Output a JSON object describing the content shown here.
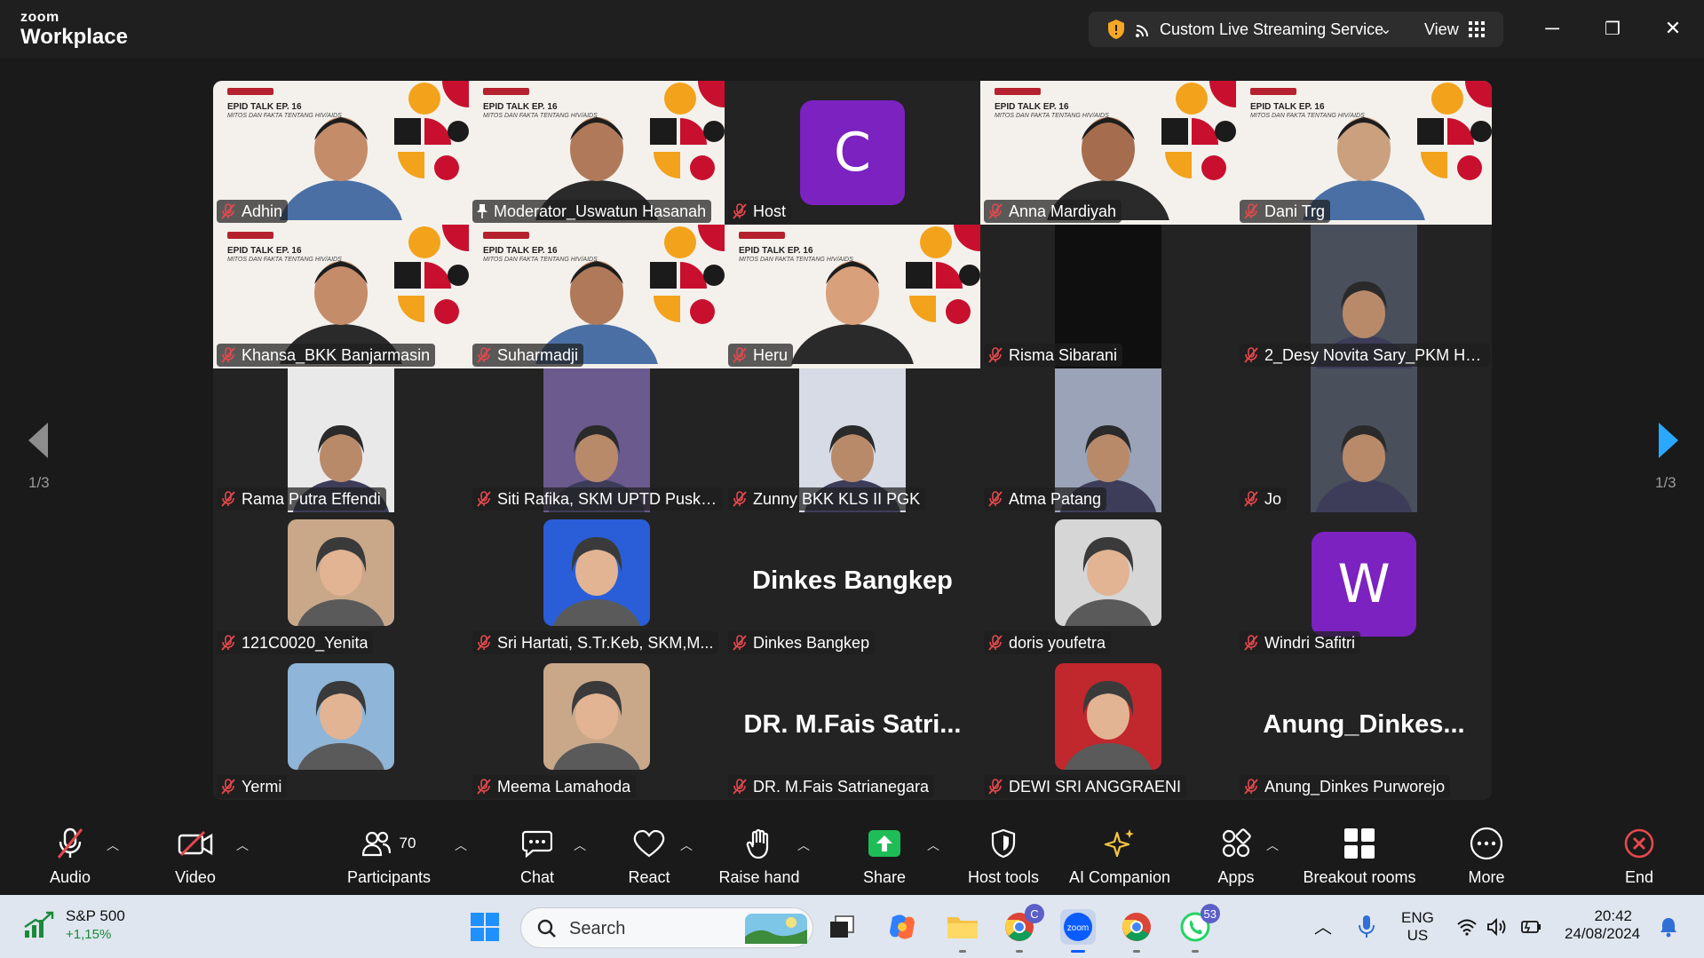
{
  "app": {
    "brand_small": "zoom",
    "brand_large": "Workplace"
  },
  "titlebar": {
    "live_label": "Custom Live Streaming Service",
    "view_label": "View",
    "minimize": "─",
    "restore": "❐",
    "close": "✕"
  },
  "pager": {
    "left_count": "1/3",
    "right_count": "1/3"
  },
  "participants_grid": [
    {
      "name": "Adhin",
      "type": "slide"
    },
    {
      "name": "Moderator_Uswatun Hasanah",
      "type": "slide",
      "speaking": true,
      "pinned": true
    },
    {
      "name": "Host",
      "type": "letter",
      "letter": "C",
      "color": "#7b22c0"
    },
    {
      "name": "Anna Mardiyah",
      "type": "slide"
    },
    {
      "name": "Dani Trg",
      "type": "slide"
    },
    {
      "name": "Khansa_BKK Banjarmasin",
      "type": "slide"
    },
    {
      "name": "Suharmadji",
      "type": "slide"
    },
    {
      "name": "Heru",
      "type": "slide"
    },
    {
      "name": "Risma Sibarani",
      "type": "video-dark"
    },
    {
      "name": "2_Desy Novita Sary_PKM HU...",
      "type": "video"
    },
    {
      "name": "Rama Putra Effendi",
      "type": "video"
    },
    {
      "name": "Siti Rafika, SKM UPTD Puske...",
      "type": "video"
    },
    {
      "name": "Zunny BKK KLS II PGK",
      "type": "video"
    },
    {
      "name": "Atma Patang",
      "type": "video"
    },
    {
      "name": "Jo",
      "type": "video"
    },
    {
      "name": "121C0020_Yenita",
      "type": "photo"
    },
    {
      "name": "Sri Hartati, S.Tr.Keb, SKM,M...",
      "type": "photo"
    },
    {
      "name": "Dinkes Bangkep",
      "type": "text",
      "big": "Dinkes Bangkep"
    },
    {
      "name": "doris youfetra",
      "type": "photo"
    },
    {
      "name": "Windri Safitri",
      "type": "letter",
      "letter": "W",
      "color": "#7b22c0"
    },
    {
      "name": "Yermi",
      "type": "photo"
    },
    {
      "name": "Meema Lamahoda",
      "type": "photo"
    },
    {
      "name": "DR. M.Fais Satrianegara",
      "type": "text",
      "big": "DR. M.Fais Satri..."
    },
    {
      "name": "DEWI SRI ANGGRAENI",
      "type": "photo"
    },
    {
      "name": "Anung_Dinkes Purworejo",
      "type": "text",
      "big": "Anung_Dinkes..."
    }
  ],
  "slide": {
    "title": "EPID TALK EP. 16",
    "subtitle": "MITOS DAN FAKTA TENTANG HIV/AIDS"
  },
  "toolbar": {
    "audio": "Audio",
    "video": "Video",
    "participants": "Participants",
    "participants_count": "70",
    "chat": "Chat",
    "react": "React",
    "raise_hand": "Raise hand",
    "share": "Share",
    "host_tools": "Host tools",
    "ai_companion": "AI Companion",
    "apps": "Apps",
    "breakout_rooms": "Breakout rooms",
    "more": "More",
    "end": "End"
  },
  "taskbar": {
    "stock_name": "S&P 500",
    "stock_change": "+1,15%",
    "search": "Search",
    "chrome_badge": "C",
    "whatsapp_badge": "53",
    "lang_1": "ENG",
    "lang_2": "US",
    "time": "20:42",
    "date": "24/08/2024"
  },
  "colors": {
    "accent_green": "#23d96b",
    "muted_red": "#e5484d",
    "share_green": "#1fbd57",
    "zoom_blue": "#0b5cff"
  }
}
